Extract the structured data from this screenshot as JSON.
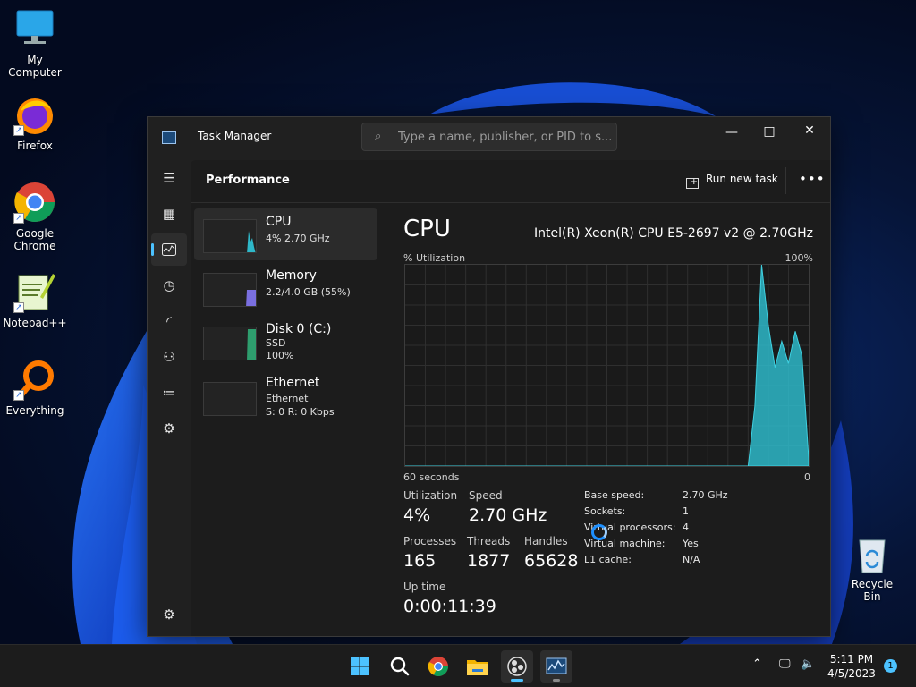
{
  "desktop": {
    "icons": [
      {
        "label": "My Computer",
        "icon": "monitor-icon"
      },
      {
        "label": "Firefox",
        "icon": "firefox-icon"
      },
      {
        "label": "Google Chrome",
        "icon": "chrome-icon"
      },
      {
        "label": "Notepad++",
        "icon": "notepadpp-icon"
      },
      {
        "label": "Everything",
        "icon": "everything-icon"
      }
    ],
    "recycle_bin": "Recycle Bin"
  },
  "window": {
    "title": "Task Manager",
    "search_placeholder": "Type a name, publisher, or PID to s...",
    "controls": {
      "minimize": "—",
      "maximize": "□",
      "close": "✕"
    },
    "page_title": "Performance",
    "run_new_task": "Run new task",
    "more": "•••",
    "rail": [
      "menu-icon",
      "processes-icon",
      "performance-icon",
      "app-history-icon",
      "startup-apps-icon",
      "users-icon",
      "details-icon",
      "services-icon",
      "settings-icon"
    ]
  },
  "devices": [
    {
      "name": "CPU",
      "line1": "4% 2.70 GHz",
      "line2": "",
      "active": true
    },
    {
      "name": "Memory",
      "line1": "2.2/4.0 GB (55%)",
      "line2": ""
    },
    {
      "name": "Disk 0 (C:)",
      "line1": "SSD",
      "line2": "100%"
    },
    {
      "name": "Ethernet",
      "line1": "Ethernet",
      "line2": "S: 0 R: 0 Kbps"
    }
  ],
  "cpu": {
    "title": "CPU",
    "model": "Intel(R) Xeon(R) CPU E5-2697 v2 @ 2.70GHz",
    "graph_label": "% Utilization",
    "graph_max": "100%",
    "time_left": "60 seconds",
    "time_right": "0",
    "stats": {
      "utilization": {
        "label": "Utilization",
        "value": "4%"
      },
      "speed": {
        "label": "Speed",
        "value": "2.70 GHz"
      },
      "processes": {
        "label": "Processes",
        "value": "165"
      },
      "threads": {
        "label": "Threads",
        "value": "1877"
      },
      "handles": {
        "label": "Handles",
        "value": "65628"
      },
      "uptime": {
        "label": "Up time",
        "value": "0:00:11:39"
      }
    },
    "specs": [
      {
        "label": "Base speed:",
        "value": "2.70 GHz"
      },
      {
        "label": "Sockets:",
        "value": "1"
      },
      {
        "label": "Virtual processors:",
        "value": "4"
      },
      {
        "label": "Virtual machine:",
        "value": "Yes"
      },
      {
        "label": "L1 cache:",
        "value": "N/A"
      }
    ],
    "graph_color": "#2eb8c9"
  },
  "chart_data": {
    "type": "area",
    "x": [
      60,
      55,
      50,
      45,
      40,
      35,
      30,
      25,
      20,
      15,
      14,
      13,
      12,
      11,
      10,
      9,
      8,
      7,
      6,
      5,
      4,
      3,
      2,
      1,
      0
    ],
    "values": [
      0,
      0,
      0,
      0,
      0,
      0,
      0,
      0,
      0,
      0,
      0,
      0,
      0,
      0,
      0,
      0,
      30,
      100,
      70,
      49,
      62,
      51,
      67,
      55,
      4
    ],
    "xlabel": "60 seconds",
    "ylabel": "% Utilization",
    "ylim": [
      0,
      100
    ]
  },
  "taskbar": {
    "apps": [
      "start-icon",
      "search-icon",
      "chrome-icon",
      "file-explorer-icon",
      "obs-icon",
      "task-manager-icon"
    ],
    "clock_time": "5:11 PM",
    "clock_date": "4/5/2023",
    "notification_count": "1",
    "accent": "#4cc2ff"
  }
}
